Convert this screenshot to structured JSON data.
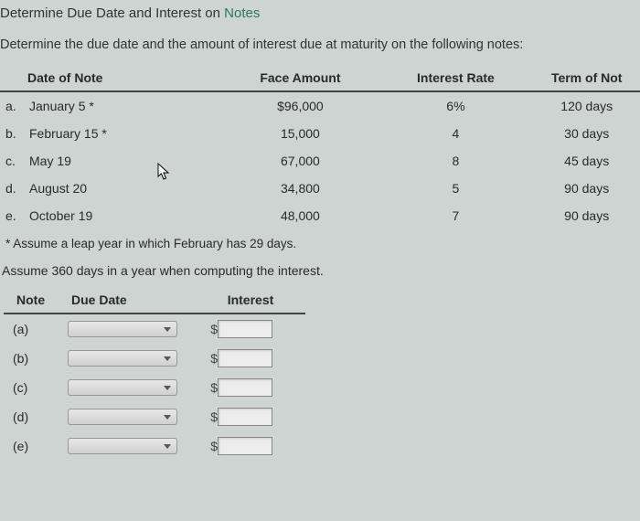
{
  "title_prefix": "Determine Due Date and Interest on ",
  "title_link": "Notes",
  "subtitle": "Determine the due date and the amount of interest due at maturity on the following notes:",
  "headers": {
    "date": "Date of Note",
    "face": "Face Amount",
    "rate": "Interest Rate",
    "term": "Term of Not"
  },
  "notes": [
    {
      "letter": "a.",
      "date": "January 5 *",
      "face": "$96,000",
      "rate": "6%",
      "term": "120 days"
    },
    {
      "letter": "b.",
      "date": "February 15 *",
      "face": "15,000",
      "rate": "4",
      "term": "30 days"
    },
    {
      "letter": "c.",
      "date": "May 19",
      "face": "67,000",
      "rate": "8",
      "term": "45 days"
    },
    {
      "letter": "d.",
      "date": "August 20",
      "face": "34,800",
      "rate": "5",
      "term": "90 days"
    },
    {
      "letter": "e.",
      "date": "October 19",
      "face": "48,000",
      "rate": "7",
      "term": "90 days"
    }
  ],
  "footnote": "* Assume a leap year in which February has 29 days.",
  "assumption": "Assume 360 days in a year when computing the interest.",
  "answer_headers": {
    "note": "Note",
    "duedate": "Due Date",
    "interest": "Interest"
  },
  "answer_rows": [
    "(a)",
    "(b)",
    "(c)",
    "(d)",
    "(e)"
  ],
  "dollar": "$"
}
